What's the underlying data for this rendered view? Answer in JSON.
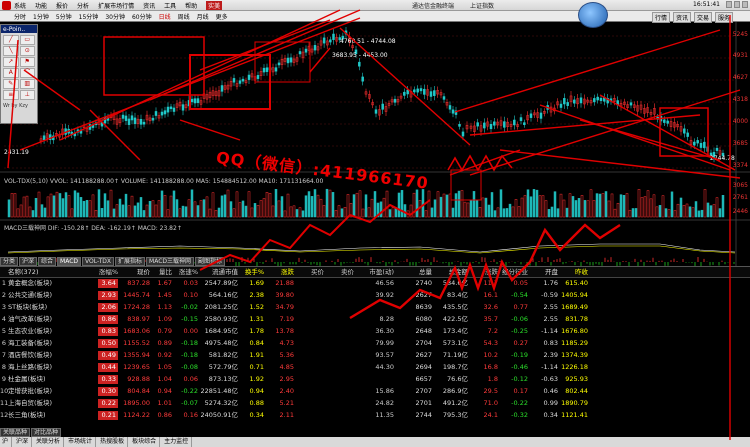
{
  "menubar": {
    "items": [
      "系统",
      "功能",
      "报价",
      "分析",
      "扩展市场行情",
      "资讯",
      "工具",
      "帮助"
    ],
    "highlight": "实美",
    "title": "通达信金融终端",
    "subtitle": "上证指数",
    "clock": "16:51:41"
  },
  "toolbar": {
    "items": [
      "分时",
      "1分钟",
      "5分钟",
      "15分钟",
      "30分钟",
      "60分钟",
      "日线",
      "周线",
      "月线",
      "更多"
    ],
    "active_index": 6,
    "right_buttons": [
      "行情",
      "资讯",
      "交易",
      "服务"
    ]
  },
  "palette": {
    "title": "e-Poin..",
    "tools": [
      "╱",
      "▭",
      "╲",
      "⊙",
      "↗",
      "⚑",
      "A",
      "⌒",
      "✎",
      "▥",
      "≡",
      "⊥"
    ],
    "footer": "Wr by Kzy"
  },
  "chart": {
    "y_labels": [
      "5245",
      "4931",
      "4627",
      "4318",
      "4000",
      "3685",
      "3374",
      "3065",
      "2761",
      "2446"
    ],
    "price_note_1": "3683.95 - 4453.00",
    "price_note_2": "4760.51 - 4744.08",
    "right_note": "2744.78",
    "left_note": "2431.19",
    "watermark": "QQ（微信）:411966170",
    "vol_bar": "VOL-TDX(5,10) VVOL: 141188288.00↑  VOLUME: 141188288.00  MA5: 154884512.00  MA10: 171131664.00",
    "macd_bar": "MACD三载神网 DIF: -150.28↑  DEA: -162.19↑  MACD: 23.82↑"
  },
  "tabs_top": [
    "分类",
    "沪深",
    "综合",
    "MACD",
    "VOL-TDX",
    "扩展指标",
    "MACD三载神网",
    "副图指标"
  ],
  "table": {
    "headers": [
      "",
      "名称(372)",
      "涨幅%",
      "现价",
      "量比",
      "涨速%",
      "流通市值",
      "换手%",
      "涨跌",
      "买价",
      "卖价",
      "市盈(动)",
      "总量",
      "总金额",
      "涨跌",
      "细分行业",
      "开盘",
      "昨收"
    ],
    "rows": [
      [
        "1",
        "黄金概念(板块)",
        "3.64",
        "837.28",
        "1.67",
        "0.03",
        "2547.89亿",
        "1.69",
        "21.88",
        "",
        "",
        "46.56",
        "2740",
        "584.6亿",
        "11.7",
        "0.05",
        "1.76",
        "615.40"
      ],
      [
        "2",
        "公共交通(板块)",
        "2.93",
        "1445.74",
        "1.45",
        "0.10",
        "564.16亿",
        "2.38",
        "39.80",
        "",
        "",
        "39.92",
        "2627",
        "83.4亿",
        "16.1",
        "-0.54",
        "-0.59",
        "1405.94"
      ],
      [
        "3",
        "ST板块(板块)",
        "2.06",
        "1724.28",
        "1.13",
        "-0.02",
        "2081.25亿",
        "1.52",
        "34.79",
        "",
        "",
        "",
        "8639",
        "435.5亿",
        "32.6",
        "0.77",
        "2.55",
        "1689.49"
      ],
      [
        "4",
        "油气改革(板块)",
        "0.86",
        "838.97",
        "1.09",
        "-0.15",
        "2580.93亿",
        "1.31",
        "7.19",
        "",
        "",
        "8.28",
        "6080",
        "422.5亿",
        "35.7",
        "-0.06",
        "2.55",
        "831.78"
      ],
      [
        "5",
        "生态农业(板块)",
        "0.83",
        "1683.06",
        "0.79",
        "0.00",
        "1684.95亿",
        "1.78",
        "13.78",
        "",
        "",
        "36.30",
        "2648",
        "173.4亿",
        "7.2",
        "-0.25",
        "-1.14",
        "1676.80"
      ],
      [
        "6",
        "海工装备(板块)",
        "0.50",
        "1155.52",
        "0.89",
        "-0.18",
        "4975.48亿",
        "0.84",
        "4.73",
        "",
        "",
        "79.99",
        "2704",
        "573.1亿",
        "54.3",
        "0.27",
        "0.83",
        "1185.29"
      ],
      [
        "7",
        "酒店餐饮(板块)",
        "0.49",
        "1355.94",
        "0.92",
        "-0.18",
        "581.82亿",
        "1.91",
        "5.36",
        "",
        "",
        "93.57",
        "2627",
        "71.19亿",
        "10.2",
        "-0.19",
        "2.39",
        "1374.39"
      ],
      [
        "8",
        "海上丝路(板块)",
        "0.44",
        "1239.65",
        "1.05",
        "-0.08",
        "572.79亿",
        "0.71",
        "4.85",
        "",
        "",
        "44.30",
        "2694",
        "198.7亿",
        "16.8",
        "-0.46",
        "-1.14",
        "1226.18"
      ],
      [
        "9",
        "杜金属(板块)",
        "0.33",
        "928.88",
        "1.04",
        "0.06",
        "873.13亿",
        "1.92",
        "2.95",
        "",
        "",
        "",
        "6657",
        "76.6亿",
        "1.8",
        "-0.12",
        "-0.63",
        "925.93"
      ],
      [
        "10",
        "定增获批(板块)",
        "0.30",
        "804.84",
        "0.94",
        "-0.22",
        "22851.48亿",
        "0.94",
        "2.40",
        "",
        "",
        "15.86",
        "2707",
        "286.9亿",
        "29.5",
        "0.17",
        "0.46",
        "802.44"
      ],
      [
        "11",
        "上海自贸(板块)",
        "0.22",
        "1895.00",
        "1.01",
        "-0.07",
        "5274.32亿",
        "0.88",
        "5.21",
        "",
        "",
        "24.82",
        "2701",
        "491.2亿",
        "71.0",
        "-0.22",
        "0.99",
        "1890.79"
      ],
      [
        "12",
        "长三角(板块)",
        "0.21",
        "1124.22",
        "0.86",
        "0.16",
        "24050.91亿",
        "0.34",
        "2.11",
        "",
        "",
        "11.35",
        "2744",
        "795.3亿",
        "24.1",
        "-0.32",
        "0.34",
        "1121.41"
      ]
    ]
  },
  "tabs_bottom": [
    "关联品种",
    "对比品种"
  ],
  "status": [
    "沪",
    "沪深",
    "关联分析",
    "市场统计",
    "热搜股板",
    "板块综合",
    "主力监控"
  ],
  "colors": {
    "up": "#ff3b3b",
    "down": "#2be02b",
    "accent": "#e00000"
  }
}
